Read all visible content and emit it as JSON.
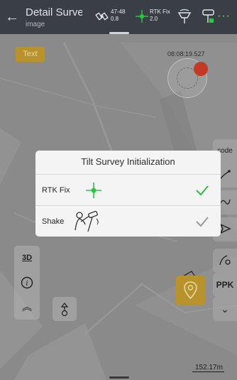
{
  "header": {
    "back_icon": "back-arrow-icon",
    "title": "Detail Surve",
    "subtitle": "image",
    "satellites": {
      "line1": "47-48",
      "line2": "0.8"
    },
    "solution": {
      "line1": "RTK Fix",
      "line2": "2.0"
    },
    "more_icon": "more-dots-icon"
  },
  "map": {
    "text_button_label": "Text",
    "time": "08:08:19.527",
    "scale_label": "152.17m",
    "ppk_label": "PPK",
    "code_label": "code",
    "btn_3d_label": "3D"
  },
  "dialog": {
    "title": "Tilt Survey Initialization",
    "options": [
      {
        "label": "RTK Fix",
        "selected": true
      },
      {
        "label": "Shake",
        "selected": false
      }
    ]
  },
  "colors": {
    "accent_gold": "#b8922d",
    "check_green": "#37b34a",
    "check_gray": "#9a9a9a",
    "topbar": "#3a3f45",
    "compass_dot": "#c23a26"
  }
}
